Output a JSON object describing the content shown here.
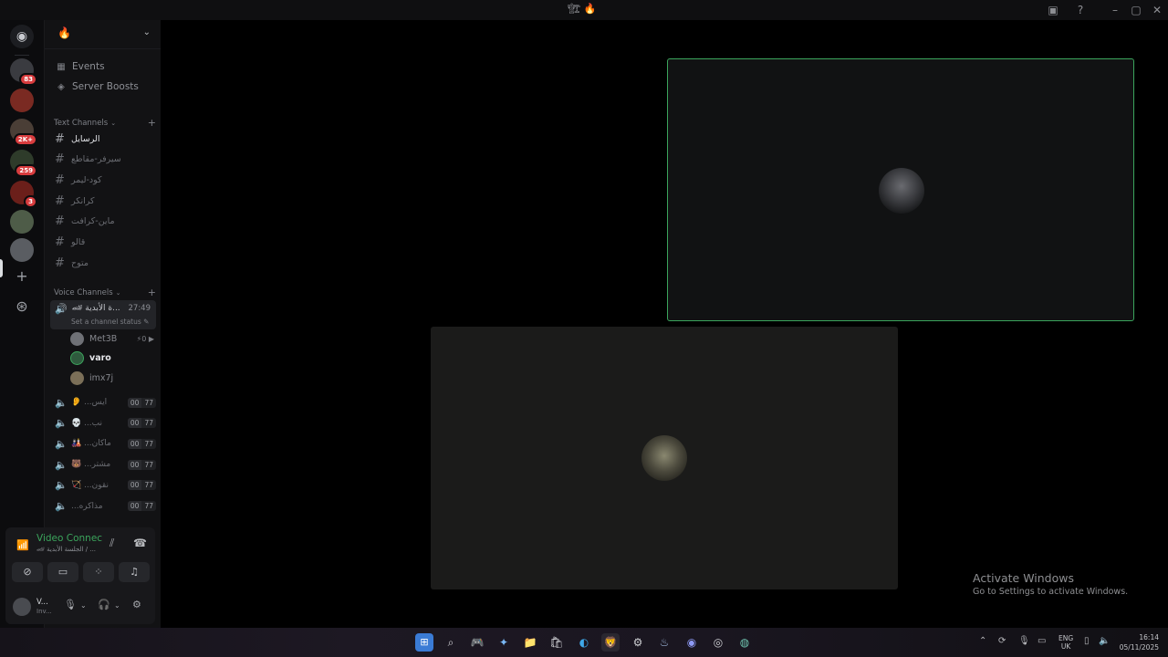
{
  "titlebar": {
    "title": "🏗 🔥"
  },
  "servers": [
    {
      "name": "server-1",
      "badge": "83",
      "color": "#3a3b40"
    },
    {
      "name": "server-2",
      "badge": "",
      "color": "#7a2a22"
    },
    {
      "name": "server-3",
      "badge": "2K+",
      "color": "#4a3e36"
    },
    {
      "name": "server-4",
      "badge": "259",
      "color": "#2e3b2a"
    },
    {
      "name": "server-5",
      "badge": "3",
      "color": "#6b1f1a"
    },
    {
      "name": "server-6",
      "badge": "",
      "color": "#4e5c48"
    },
    {
      "name": "server-7",
      "badge": "",
      "color": "#5a5d62"
    }
  ],
  "server_header": {
    "name": "🔥"
  },
  "menu": {
    "events": "Events",
    "boosts": "Server Boosts"
  },
  "text_category": "Text Channels",
  "text_channels": [
    "الرسايل",
    "سيرفر-مقاطع",
    "كود-ليمر",
    "كرانكر",
    "ماين-كرافت",
    "قالو",
    "متوح"
  ],
  "voice_category": "Voice Channels",
  "active_voice": {
    "name": "🏎 ة الأبدية...",
    "time": "27:49",
    "status": "Set a channel status ✎"
  },
  "voice_users": [
    {
      "name": "Met3B",
      "meta": "⚡0  ▶"
    },
    {
      "name": "varo",
      "meta": ""
    },
    {
      "name": "imx7j",
      "meta": ""
    }
  ],
  "voice_channels": [
    {
      "name": "👂 ...ايس",
      "a": "00",
      "b": "77"
    },
    {
      "name": "💀 ...نب",
      "a": "00",
      "b": "77"
    },
    {
      "name": "🎎 ...ماكان",
      "a": "00",
      "b": "77"
    },
    {
      "name": "🐻 ...مشتر",
      "a": "00",
      "b": "77"
    },
    {
      "name": "🏹 ...نقون",
      "a": "00",
      "b": "77"
    },
    {
      "name": "...مذاكره",
      "a": "00",
      "b": "77"
    }
  ],
  "rtc": {
    "label": "Video Connected",
    "sub": "🏎 الجلسة الأبدية / ..."
  },
  "user_panel": {
    "name": "V...",
    "status": "Inv..."
  },
  "watermark": {
    "line1": "Activate Windows",
    "line2": "Go to Settings to activate Windows."
  },
  "taskbar": {
    "lang_top": "ENG",
    "lang_bottom": "UK",
    "time": "16:14",
    "date": "05/11/2025"
  },
  "colors": {
    "accent_green": "#3ba55c",
    "badge_red": "#d83c3e"
  }
}
